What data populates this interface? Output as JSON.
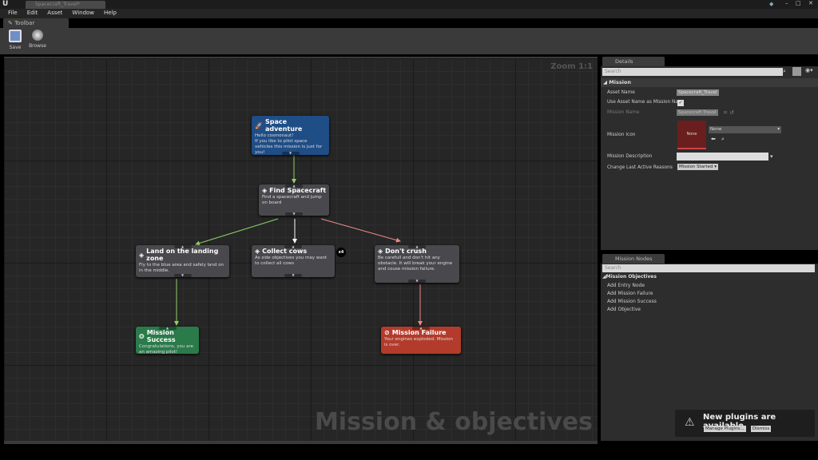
{
  "window": {
    "tab_title": "Spacecraft_Travel*"
  },
  "menu": [
    "File",
    "Edit",
    "Asset",
    "Window",
    "Help"
  ],
  "toolbar": {
    "tab_label": "Toolbar",
    "save_label": "Save",
    "browse_label": "Browse"
  },
  "graph": {
    "zoom": "Zoom 1:1",
    "watermark": "Mission & objectives",
    "nodes": [
      {
        "title": "Space adventure",
        "desc": "Hello cosmonaut!\nIf you like to pilot space vehicles this mission is just for you!",
        "icon": "rocket-icon",
        "color": "#1f4d86"
      },
      {
        "title": "Find Spacecraft",
        "desc": "Find a spacecraft and jump on board",
        "icon": "objective-icon",
        "color": "#48484d"
      },
      {
        "title": "Land on the landing zone",
        "desc": "Fly to the blue area and safely land on in the middle.",
        "icon": "objective-icon",
        "color": "#48484d"
      },
      {
        "title": "Collect cows",
        "desc": "As side objectives you may want to collect all cows",
        "icon": "objective-icon",
        "color": "#48484d",
        "badge": "x4"
      },
      {
        "title": "Don't crush",
        "desc": "Be carefull and don't hit any obstacle. It will break your engine and couse mission failure.",
        "icon": "objective-icon",
        "color": "#48484d"
      },
      {
        "title": "Mission Success",
        "desc": "Congratulations, you are an amazing pilot!",
        "icon": "medal-icon",
        "color": "#2b7a4a"
      },
      {
        "title": "Mission Failure",
        "desc": "Your engines exploded. Mission is over.",
        "icon": "no-entry-icon",
        "color": "#b33b2b"
      }
    ]
  },
  "details": {
    "tab": "Details",
    "search_placeholder": "Search",
    "section": "Mission",
    "asset_name_label": "Asset Name",
    "asset_name": "Spacecraft_Travel",
    "use_asset_label": "Use Asset Name as Mission Na",
    "use_asset_checked": true,
    "mission_name_label": "Mission Name",
    "mission_name": "Spacecraft Travel",
    "mission_icon_label": "Mission Icon",
    "icon_preview": "None",
    "icon_select": "None",
    "description_label": "Mission Description",
    "description": "",
    "change_reasons_label": "Change Last Active Reasons",
    "change_reasons": "Mission Started"
  },
  "nodes_panel": {
    "tab": "Mission Nodes",
    "search_placeholder": "Search",
    "category": "Mission Objectives",
    "items": [
      "Add Entry Node",
      "Add Mission Failure",
      "Add Mission Success",
      "Add Objective"
    ]
  },
  "notification": {
    "text": "New plugins are available",
    "manage": "Manage Plugins...",
    "dismiss": "Dismiss"
  }
}
